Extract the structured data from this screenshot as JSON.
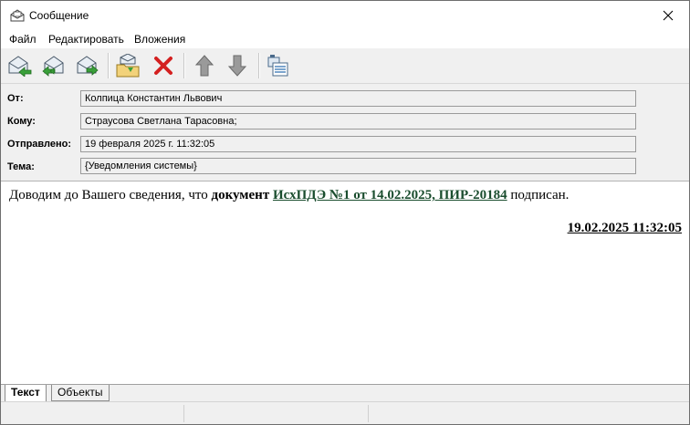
{
  "window": {
    "title": "Сообщение"
  },
  "menu": {
    "items": [
      "Файл",
      "Редактировать",
      "Вложения"
    ]
  },
  "header": {
    "from_label": "От:",
    "from_value": "Колпица Константин Львович",
    "to_label": "Кому:",
    "to_value": "Страусова Светлана Тарасовна;",
    "sent_label": "Отправлено:",
    "sent_value": "19 февраля 2025 г. 11:32:05",
    "subject_label": "Тема:",
    "subject_value": "{Уведомления системы}"
  },
  "body": {
    "text_before": "Доводим до Вашего сведения, что ",
    "doc_word": "документ",
    "doc_link": "ИсхПДЭ №1 от 14.02.2025, ПИР-20184",
    "text_after": " подписан.",
    "date": "19.02.2025 11:32:05"
  },
  "tabs": [
    "Текст",
    "Объекты"
  ],
  "colors": {
    "link": "#1a4d2e",
    "delete": "#d42020",
    "arrow": "#8a8a8a"
  },
  "icons": {
    "title": "envelope-icon",
    "toolbar": [
      "reply-icon",
      "reply-all-icon",
      "forward-icon",
      "save-to-folder-icon",
      "delete-icon",
      "previous-icon",
      "next-icon",
      "properties-icon"
    ]
  }
}
